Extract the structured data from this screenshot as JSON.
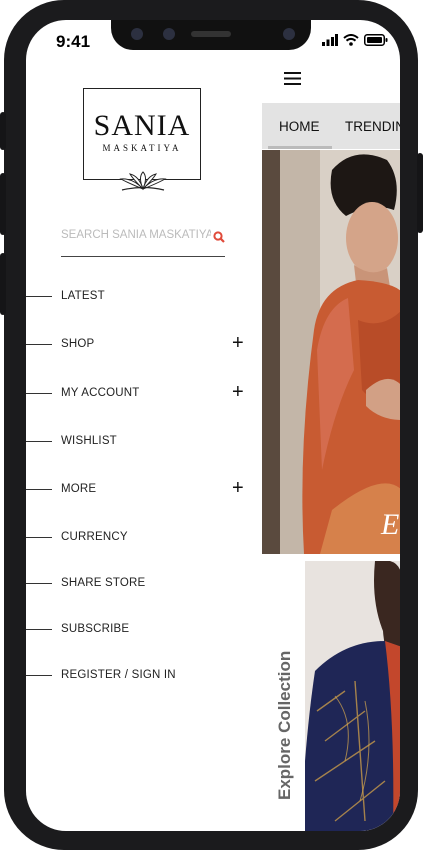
{
  "status_bar": {
    "time": "9:41"
  },
  "brand": {
    "name": "SANIA",
    "sub": "MASKATIYA"
  },
  "search": {
    "placeholder": "SEARCH SANIA MASKATIYA",
    "value": ""
  },
  "menu": {
    "items": [
      {
        "label": "LATEST",
        "expandable": false
      },
      {
        "label": "SHOP",
        "expandable": true
      },
      {
        "label": "MY ACCOUNT",
        "expandable": true
      },
      {
        "label": "WISHLIST",
        "expandable": false
      },
      {
        "label": "MORE",
        "expandable": true
      },
      {
        "label": "CURRENCY",
        "expandable": false
      },
      {
        "label": "SHARE STORE",
        "expandable": false
      },
      {
        "label": "SUBSCRIBE",
        "expandable": false
      },
      {
        "label": "REGISTER / SIGN IN",
        "expandable": false
      }
    ],
    "expand_symbol": "+"
  },
  "tabs": [
    {
      "label": "HOME"
    },
    {
      "label": "TRENDIN"
    }
  ],
  "hero": {
    "caption": "E"
  },
  "collection": {
    "label": "Explore Collection"
  },
  "colors": {
    "accent": "#e04a3a",
    "tab_bg": "#e3e3e3",
    "frame": "#1b1b1d"
  },
  "icons": [
    "search-icon",
    "hamburger-menu-icon",
    "plus-icon",
    "signal-icon",
    "wifi-icon",
    "battery-icon"
  ]
}
